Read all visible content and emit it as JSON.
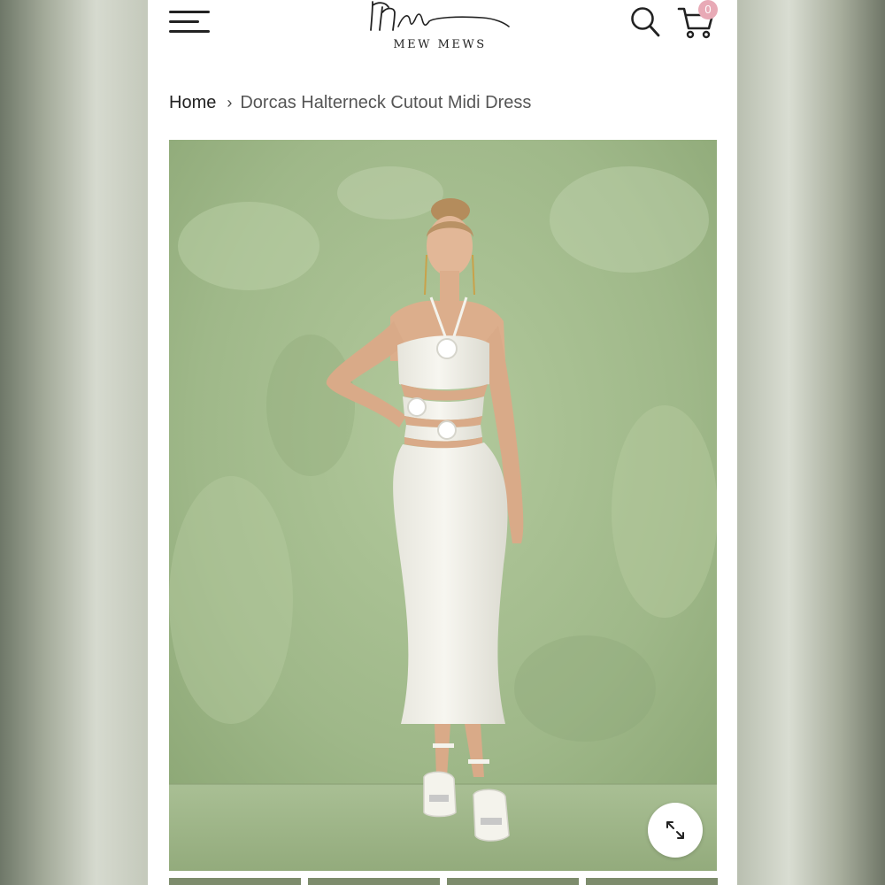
{
  "brand": {
    "name": "MEW MEWS",
    "logo_icon": "signature-script-logo"
  },
  "header": {
    "menu_icon": "hamburger-menu-icon",
    "search_icon": "search-icon",
    "cart_icon": "cart-icon",
    "cart_count": "0",
    "cart_badge_color": "#e8aab6"
  },
  "breadcrumb": {
    "home": "Home",
    "separator_icon": "chevron-right-icon",
    "current": "Dorcas Halterneck Cutout Midi Dress"
  },
  "product": {
    "image_subject": "Model wearing white halterneck cutout midi dress with rosette details against green wall",
    "background_color": "#9cb585",
    "dress_color": "#f4f3ec",
    "zoom_icon": "expand-arrows-icon"
  },
  "gallery": {
    "thumbnail_count": 4
  }
}
